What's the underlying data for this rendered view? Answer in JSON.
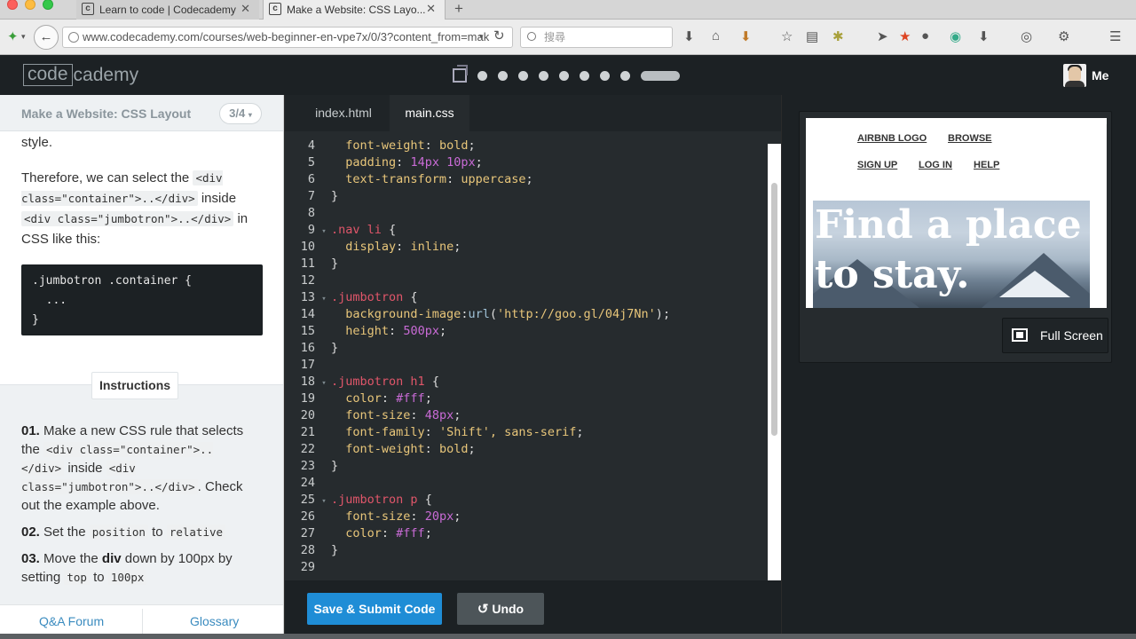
{
  "browser": {
    "tabs": [
      {
        "label": "Learn to code | Codecademy",
        "favicon": "codecademy-favicon"
      },
      {
        "label": "Make a Website: CSS Layo...",
        "favicon": "codecademy-favicon",
        "active": true
      }
    ],
    "url": "www.codecademy.com/courses/web-beginner-en-vpe7x/0/3?content_from=mak",
    "search_placeholder": "搜尋"
  },
  "header": {
    "logo_left": "code",
    "logo_right": "cademy",
    "progress_dots": 8,
    "user_label": "Me"
  },
  "lesson": {
    "title": "Make a Website: CSS Layout",
    "step": "3/4",
    "text_top": "style.",
    "para_prefix": "Therefore, we can select the",
    "code_container": "<div class=\"container\">..</div>",
    "para_mid": "inside",
    "code_jumbotron": "<div class=\"jumbotron\">..</div>",
    "para_in": "in",
    "para_suffix": "CSS like this:",
    "example_code": ".jumbotron .container {\n  ...\n}",
    "instructions_label": "Instructions",
    "instructions": [
      {
        "num": "01.",
        "text1": "Make a new CSS rule that selects the",
        "code1": "<div class=\"container\">..</div>",
        "text2": "inside",
        "code2": "<div class=\"jumbotron\">..</div>",
        "text3": ". Check out the example above."
      },
      {
        "num": "02.",
        "text1": "Set the",
        "code1": "position",
        "text2": "to",
        "code2": "relative"
      },
      {
        "num": "03.",
        "text1": "Move the",
        "bold": "div",
        "text2": "down by 100px by setting",
        "code1": "top",
        "text3": "to",
        "code2": "100px"
      }
    ],
    "footer_left": "Q&A Forum",
    "footer_right": "Glossary"
  },
  "editor": {
    "tabs": [
      "index.html",
      "main.css"
    ],
    "active_tab": "main.css",
    "submit_label": "Save & Submit Code",
    "undo_label": "Undo",
    "lines": [
      {
        "n": "4",
        "t": "  font-weight: bold;"
      },
      {
        "n": "5",
        "t": "  padding: 14px 10px;"
      },
      {
        "n": "6",
        "t": "  text-transform: uppercase;"
      },
      {
        "n": "7",
        "t": "}"
      },
      {
        "n": "8",
        "t": ""
      },
      {
        "n": "9",
        "t": ".nav li {"
      },
      {
        "n": "10",
        "t": "  display: inline;"
      },
      {
        "n": "11",
        "t": "}"
      },
      {
        "n": "12",
        "t": ""
      },
      {
        "n": "13",
        "t": ".jumbotron {"
      },
      {
        "n": "14",
        "t": "  background-image:url('http://goo.gl/04j7Nn');"
      },
      {
        "n": "15",
        "t": "  height: 500px;"
      },
      {
        "n": "16",
        "t": "}"
      },
      {
        "n": "17",
        "t": ""
      },
      {
        "n": "18",
        "t": ".jumbotron h1 {"
      },
      {
        "n": "19",
        "t": "  color: #fff;"
      },
      {
        "n": "20",
        "t": "  font-size: 48px;"
      },
      {
        "n": "21",
        "t": "  font-family: 'Shift', sans-serif;"
      },
      {
        "n": "22",
        "t": "  font-weight: bold;"
      },
      {
        "n": "23",
        "t": "}"
      },
      {
        "n": "24",
        "t": ""
      },
      {
        "n": "25",
        "t": ".jumbotron p {"
      },
      {
        "n": "26",
        "t": "  font-size: 20px;"
      },
      {
        "n": "27",
        "t": "  color: #fff;"
      },
      {
        "n": "28",
        "t": "}"
      },
      {
        "n": "29",
        "t": ""
      }
    ]
  },
  "preview": {
    "nav_links": [
      "AIRBNB LOGO",
      "BROWSE",
      "SIGN UP",
      "LOG IN",
      "HELP"
    ],
    "jumbotron_heading": "Find a place to stay.",
    "fullscreen_label": "Full Screen"
  },
  "colors": {
    "accent_blue": "#1f8dd6",
    "header_dark": "#1c2124",
    "editor_bg": "#262b2e",
    "selector_red": "#e0566a",
    "value_yellow": "#e8c67a",
    "number_purple": "#c96bd6"
  }
}
